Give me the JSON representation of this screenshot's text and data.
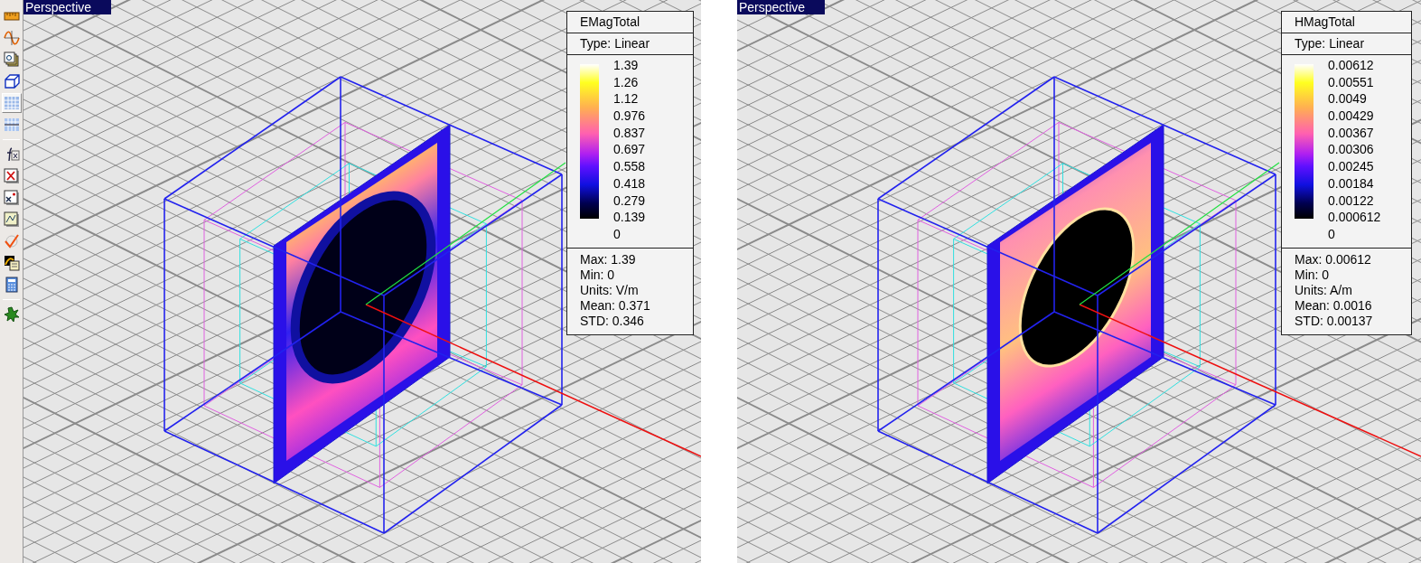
{
  "toolbar": {
    "groups": [
      [
        {
          "kind": "ruler",
          "selected": false
        },
        {
          "kind": "wave",
          "selected": false
        },
        {
          "kind": "stack",
          "selected": false
        },
        {
          "kind": "box",
          "selected": false
        },
        {
          "kind": "grid",
          "selected": true
        },
        {
          "kind": "grid2",
          "selected": false
        }
      ],
      [
        {
          "kind": "fx",
          "selected": false
        },
        {
          "kind": "xred",
          "selected": false
        },
        {
          "kind": "xsq",
          "selected": false
        },
        {
          "kind": "chartdoc",
          "selected": false
        },
        {
          "kind": "check",
          "selected": false
        },
        {
          "kind": "plotdoc",
          "selected": false
        },
        {
          "kind": "calc",
          "selected": false
        }
      ],
      [
        {
          "kind": "burst",
          "selected": false
        }
      ]
    ]
  },
  "viewports": [
    {
      "view_label": "Perspective",
      "legend": {
        "title": "EMagTotal",
        "type": "Type: Linear",
        "scale_labels": [
          "1.39",
          "1.26",
          "1.12",
          "0.976",
          "0.837",
          "0.697",
          "0.558",
          "0.418",
          "0.279",
          "0.139",
          "0"
        ],
        "stats": [
          "Max: 1.39",
          "Min: 0",
          "Units: V/m",
          "Mean: 0.371",
          "STD: 0.346"
        ]
      }
    },
    {
      "view_label": "Perspective",
      "legend": {
        "title": "HMagTotal",
        "type": "Type: Linear",
        "scale_labels": [
          "0.00612",
          "0.00551",
          "0.0049",
          "0.00429",
          "0.00367",
          "0.00306",
          "0.00245",
          "0.00184",
          "0.00122",
          "0.000612",
          "0"
        ],
        "stats": [
          "Max: 0.00612",
          "Min: 0",
          "Units: A/m",
          "Mean: 0.0016",
          "STD: 0.00137"
        ]
      }
    }
  ]
}
